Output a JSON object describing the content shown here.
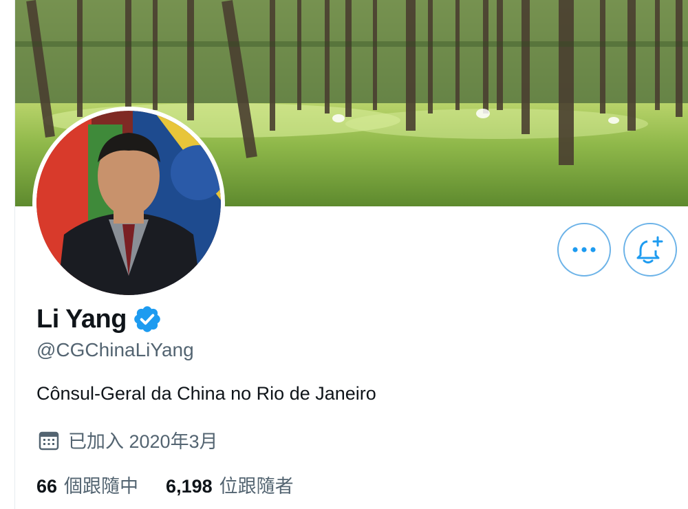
{
  "profile": {
    "name": "Li Yang",
    "handle": "@CGChinaLiYang",
    "bio": "Cônsul-Geral da China no Rio de Janeiro",
    "joined": "已加入 2020年3月",
    "verified": true
  },
  "stats": {
    "following_count": "66",
    "following_label": "個跟隨中",
    "followers_count": "6,198",
    "followers_label": "位跟隨者"
  },
  "colors": {
    "accent": "#1d9bf0",
    "button_border": "#6cb3e8",
    "secondary_text": "#536471"
  },
  "icons": {
    "more": "more-icon",
    "notify": "bell-plus-icon",
    "verified": "verified-badge-icon",
    "calendar": "calendar-icon"
  }
}
